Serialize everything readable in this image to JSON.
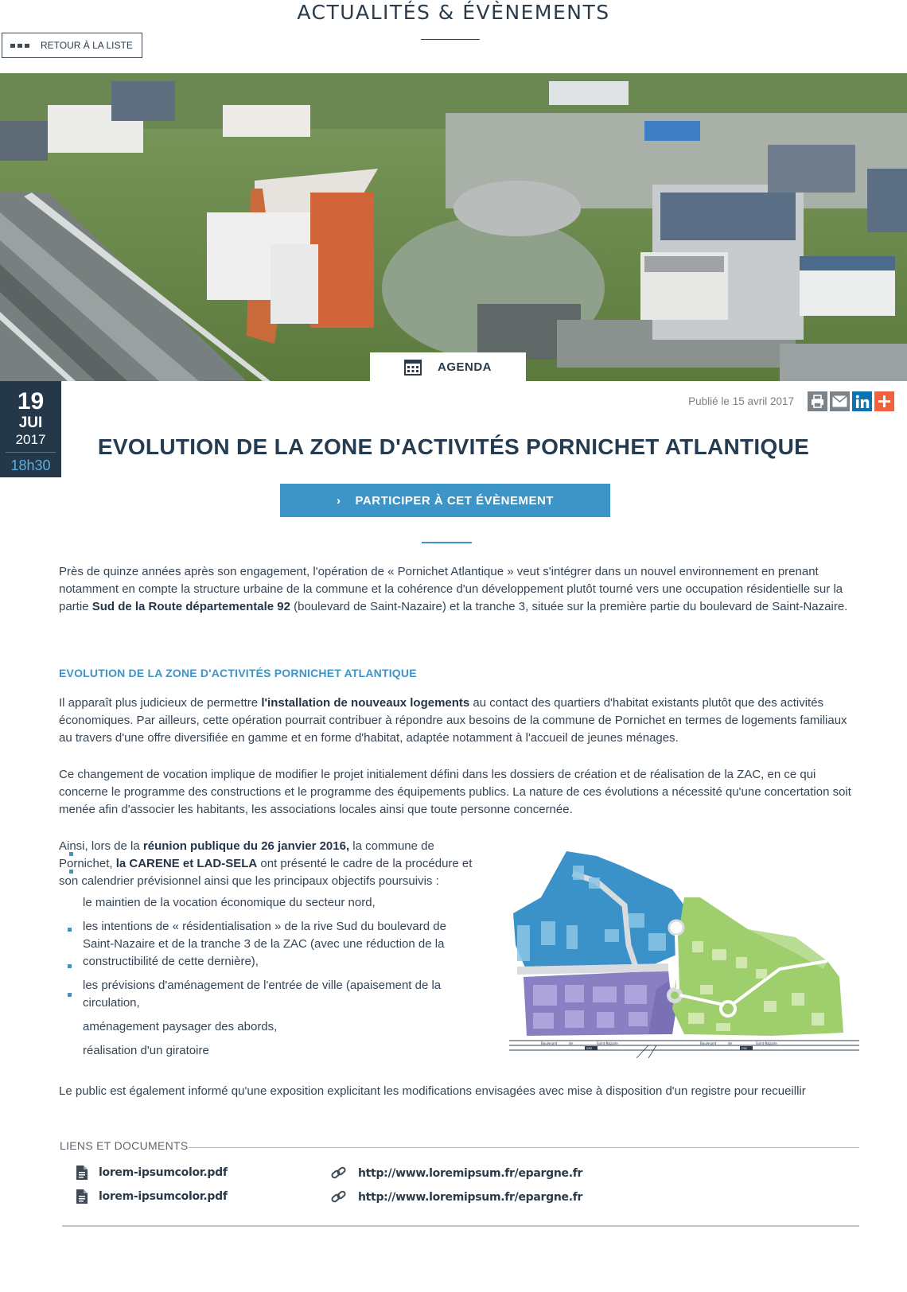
{
  "page": {
    "section_title": "ACTUALITÉS & ÉVÈNEMENTS",
    "back_label": "RETOUR À LA LISTE"
  },
  "event": {
    "category": "AGENDA",
    "date": {
      "day": "19",
      "month": "JUI",
      "year": "2017",
      "time": "18h30"
    },
    "published": "Publié le 15 avril 2017",
    "title": "EVOLUTION DE LA ZONE D'ACTIVITÉS PORNICHET ATLANTIQUE",
    "cta_label": "PARTICIPER À CET ÉVÈNEMENT",
    "cta_icon": "›"
  },
  "share": {
    "icons": [
      "print-icon",
      "email-icon",
      "linkedin-icon",
      "plus-icon"
    ],
    "colors": {
      "print": "#7b8288",
      "email": "#7b8288",
      "linkedin": "#0b74b3",
      "plus": "#f0623c"
    }
  },
  "body": {
    "p1": {
      "a": "Près de quinze années après son engagement, l'opération de « Pornichet Atlantique » veut s'intégrer dans un nouvel environnement en prenant notamment en compte la structure urbaine de la commune et la cohérence d'un développement plutôt tourné vers une occupation résidentielle sur la partie ",
      "b": "Sud de la Route départementale 92",
      "c": " (boulevard de Saint-Nazaire) et la tranche 3, située sur la première partie du boulevard de Saint-Nazaire."
    },
    "subheading": "EVOLUTION DE LA ZONE D'ACTIVITÉS PORNICHET ATLANTIQUE",
    "p2": {
      "a": "Il apparaît plus judicieux de permettre ",
      "b": "l'installation de nouveaux logements",
      "c": " au contact des quartiers d'habitat existants plutôt que des activités économiques. Par ailleurs, cette opération pourrait contribuer à répondre aux besoins de la commune de Pornichet en termes de logements familiaux au travers d'une offre diversifiée en gamme et en forme d'habitat, adaptée notamment à l'accueil de jeunes ménages."
    },
    "p3": "Ce changement de vocation implique de modifier le projet initialement défini dans les dossiers de création et de réalisation de la ZAC, en ce qui concerne le programme des constructions et le programme des équipements publics. La nature de ces évolutions a nécessité qu'une concertation soit menée afin d'associer les habitants, les associations locales ainsi que toute personne concernée.",
    "p4": {
      "a": "Ainsi, lors de la ",
      "b": "réunion publique du 26 janvier 2016,",
      "c": " la commune de Pornichet, ",
      "d": "la CARENE et LAD-SELA",
      "e": " ont présenté le cadre de la procédure et son calendrier prévisionnel ainsi que les principaux objectifs poursuivis :"
    },
    "bullets": [
      "le maintien de la vocation économique du secteur nord,",
      "les intentions de « résidentialisation » de la rive Sud du boulevard de Saint-Nazaire et de la tranche 3 de la ZAC (avec une réduction de la constructibilité de cette dernière),",
      "les prévisions d'aménagement de l'entrée de ville (apaisement de la circulation,",
      "aménagement paysager des abords,",
      "réalisation d'un giratoire"
    ],
    "p5": "Le public est également informé qu'une exposition explicitant les modifications envisagées avec mise à disposition d'un registre pour recueillir"
  },
  "map": {
    "road_labels": [
      "Boulevard",
      "de",
      "Saint-Nazaire",
      "Boulevard",
      "de",
      "Saint-Nazaire"
    ],
    "road_code": "D92",
    "colors": {
      "north": "#3a92c8",
      "south": "#8a7fc2",
      "east": "#9fcf6d"
    }
  },
  "documents": {
    "heading": "LIENS ET DOCUMENTS",
    "files": [
      "lorem-ipsumcolor.pdf",
      "lorem-ipsumcolor.pdf"
    ],
    "links": [
      "http://www.loremipsum.fr/epargne.fr",
      "http://www.loremipsum.fr/epargne.fr"
    ]
  }
}
